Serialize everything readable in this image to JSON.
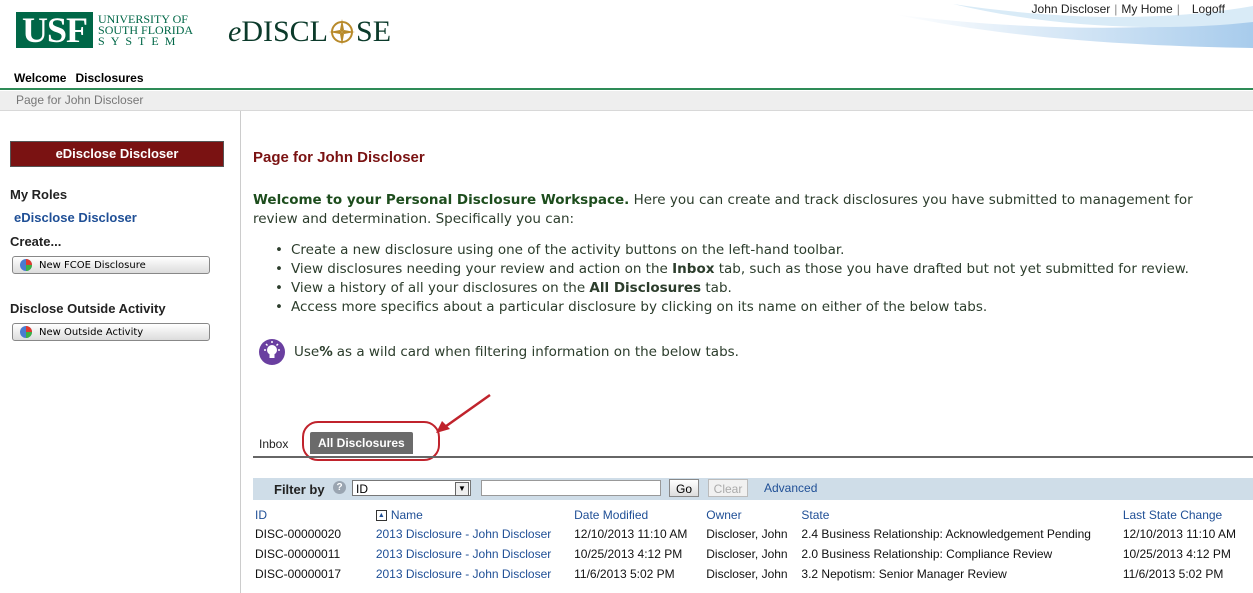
{
  "header": {
    "usf_logo": {
      "block": "USF",
      "line1": "UNIVERSITY OF",
      "line2": "SOUTH FLORIDA",
      "line3": "SYSTEM"
    },
    "app_logo": {
      "prefix": "e",
      "part1": "DISCL",
      "part2": "SE"
    },
    "user_name": "John Discloser",
    "my_home": "My Home",
    "logoff": "Logoff"
  },
  "nav": {
    "welcome": "Welcome",
    "disclosures": "Disclosures"
  },
  "breadcrumb": "Page for John Discloser",
  "sidebar": {
    "role_header": "eDisclose Discloser",
    "my_roles_label": "My Roles",
    "role_link": "eDisclose Discloser",
    "create_label": "Create...",
    "new_fcoe_button": "New FCOE Disclosure",
    "outside_label": "Disclose Outside Activity",
    "new_outside_button": "New Outside Activity"
  },
  "main": {
    "page_title": "Page for John Discloser",
    "intro_bold": "Welcome to your Personal Disclosure Workspace.",
    "intro_rest": " Here you can create and track disclosures you have submitted to management for review and determination. Specifically you can:",
    "bullets": [
      {
        "pre": "Create a new disclosure using one of the activity buttons on the left-hand toolbar.",
        "bold": "",
        "post": ""
      },
      {
        "pre": "View disclosures needing your review and action on the ",
        "bold": "Inbox",
        "post": " tab, such as those you have drafted but not yet submitted for review."
      },
      {
        "pre": "View a history of all your disclosures on the ",
        "bold": "All Disclosures",
        "post": " tab."
      },
      {
        "pre": "Access more specifics about a particular disclosure by clicking on its name on either of the below tabs.",
        "bold": "",
        "post": ""
      }
    ],
    "tip_pre": "Use ",
    "tip_bold": "%",
    "tip_post": " as a wild card when filtering information on the below tabs."
  },
  "tabs": {
    "inbox": "Inbox",
    "all": "All Disclosures"
  },
  "filter": {
    "label": "Filter by",
    "selected": "ID",
    "value": "",
    "go": "Go",
    "clear": "Clear",
    "advanced": "Advanced"
  },
  "table": {
    "columns": [
      "ID",
      "Name",
      "Date Modified",
      "Owner",
      "State",
      "Last State Change"
    ],
    "rows": [
      [
        "DISC-00000020",
        "2013 Disclosure - John Discloser",
        "12/10/2013 11:10 AM",
        "Discloser, John",
        "2.4 Business Relationship: Acknowledgement Pending",
        "12/10/2013 11:10 AM"
      ],
      [
        "DISC-00000011",
        "2013 Disclosure - John Discloser",
        "10/25/2013 4:12 PM",
        "Discloser, John",
        "2.0 Business Relationship: Compliance Review",
        "10/25/2013 4:12 PM"
      ],
      [
        "DISC-00000017",
        "2013 Disclosure - John Discloser",
        "11/6/2013 5:02 PM",
        "Discloser, John",
        "3.2 Nepotism: Senior Manager Review",
        "11/6/2013 5:02 PM"
      ]
    ]
  },
  "colors": {
    "usf_green": "#006747",
    "maroon": "#7a1212",
    "link": "#1f4f96",
    "highlight": "#c0232c"
  }
}
